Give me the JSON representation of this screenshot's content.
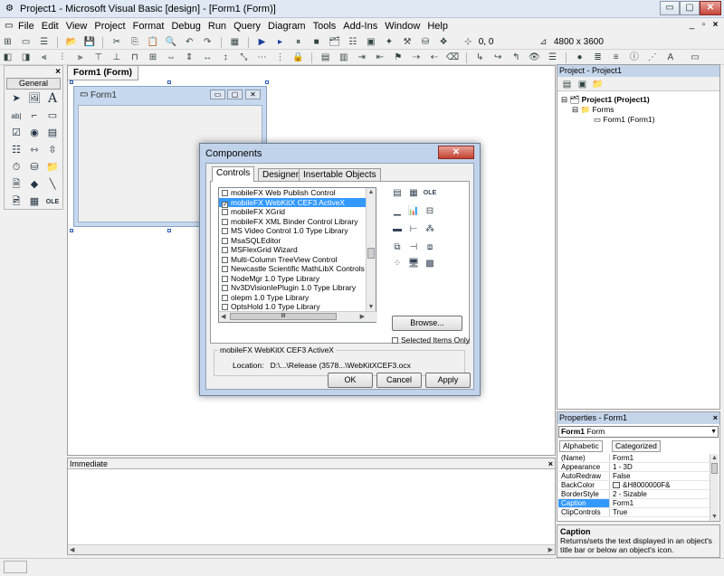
{
  "window": {
    "title": "Project1 - Microsoft Visual Basic [design] - [Form1 (Form)]",
    "controls": {
      "minimize": "▭",
      "maximize": "▢",
      "close": "✕"
    }
  },
  "menu": {
    "items": [
      "File",
      "Edit",
      "View",
      "Project",
      "Format",
      "Debug",
      "Run",
      "Query",
      "Diagram",
      "Tools",
      "Add-Ins",
      "Window",
      "Help"
    ],
    "mdi_controls": {
      "minimize": "_",
      "restore": "▫",
      "close": "×"
    }
  },
  "toolbar": {
    "coords": "0, 0",
    "size": "4800 x 3600"
  },
  "toolbox": {
    "tab_label": "General",
    "close": "×"
  },
  "designer": {
    "tab_label": "Form1 (Form)",
    "form_caption": "Form1"
  },
  "dialog": {
    "title": "Components",
    "close": "✕",
    "tabs": [
      "Controls",
      "Designers",
      "Insertable Objects"
    ],
    "active_tab": "Controls",
    "components": [
      {
        "label": "mobileFX Web Publish Control",
        "checked": false,
        "selected": false
      },
      {
        "label": "mobileFX WebKitX CEF3 ActiveX",
        "checked": true,
        "selected": true
      },
      {
        "label": "mobileFX XGrid",
        "checked": false,
        "selected": false
      },
      {
        "label": "mobileFX XML Binder Control Library",
        "checked": false,
        "selected": false
      },
      {
        "label": "MS Video Control 1.0 Type Library",
        "checked": false,
        "selected": false
      },
      {
        "label": "MsaSQLEditor",
        "checked": false,
        "selected": false
      },
      {
        "label": "MSFlexGrid Wizard",
        "checked": false,
        "selected": false
      },
      {
        "label": "Multi-Column TreeView Control",
        "checked": false,
        "selected": false
      },
      {
        "label": "Newcastle Scientific MathLibX Controls",
        "checked": false,
        "selected": false
      },
      {
        "label": "NodeMgr 1.0 Type Library",
        "checked": false,
        "selected": false
      },
      {
        "label": "Nv3DVisionIePlugin 1.0 Type Library",
        "checked": false,
        "selected": false
      },
      {
        "label": "olepm 1.0 Type Library",
        "checked": false,
        "selected": false
      },
      {
        "label": "OptsHold 1.0 Type Library",
        "checked": false,
        "selected": false
      }
    ],
    "hscroll_thumb": "III",
    "browse_label": "Browse...",
    "selected_only_label": "Selected Items Only",
    "group_title": "mobileFX WebKitX CEF3 ActiveX",
    "location_label": "Location:",
    "location_value": "D:\\...\\Release (3578...\\WebKitXCEF3.ocx",
    "ok_label": "OK",
    "cancel_label": "Cancel",
    "apply_label": "Apply"
  },
  "immediate": {
    "title": "Immediate",
    "close": "×"
  },
  "project": {
    "title": "Project - Project1",
    "root": "Project1 (Project1)",
    "folder": "Forms",
    "item": "Form1 (Form1)"
  },
  "properties": {
    "title": "Properties - Form1",
    "close": "×",
    "object_name": "Form1",
    "object_type": "Form",
    "tabs": [
      "Alphabetic",
      "Categorized"
    ],
    "rows": [
      {
        "name": "(Name)",
        "value": "Form1",
        "selected": false
      },
      {
        "name": "Appearance",
        "value": "1 - 3D",
        "selected": false
      },
      {
        "name": "AutoRedraw",
        "value": "False",
        "selected": false
      },
      {
        "name": "BackColor",
        "value": "&H8000000F&",
        "selected": false
      },
      {
        "name": "BorderStyle",
        "value": "2 - Sizable",
        "selected": false
      },
      {
        "name": "Caption",
        "value": "Form1",
        "selected": true
      },
      {
        "name": "ClipControls",
        "value": "True",
        "selected": false
      }
    ],
    "desc_title": "Caption",
    "desc_text": "Returns/sets the text displayed in an object's title bar or below an object's icon."
  },
  "colors": {
    "selection": "#3399ff",
    "dialog_frame": "#c1d3ea",
    "panel_header": "#c4d5ea"
  }
}
